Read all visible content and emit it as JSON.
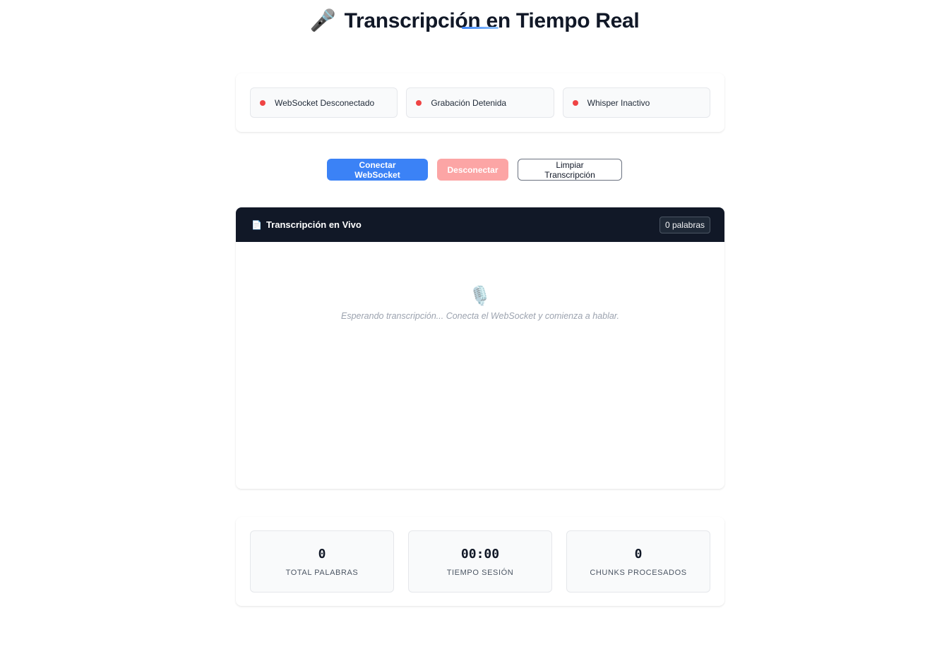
{
  "header": {
    "icon": "microphone-icon",
    "title": "Transcripción en Tiempo Real",
    "accent_color": "#3b82f6"
  },
  "status": [
    {
      "label": "WebSocket Desconectado",
      "color": "#ef4444"
    },
    {
      "label": "Grabación Detenida",
      "color": "#ef4444"
    },
    {
      "label": "Whisper Inactivo",
      "color": "#ef4444"
    }
  ],
  "controls": {
    "connect_label": "Conectar WebSocket",
    "disconnect_label": "Desconectar",
    "clear_label": "Limpiar Transcripción"
  },
  "transcript": {
    "icon": "document-icon",
    "title": "Transcripción en Vivo",
    "word_count": "0 palabras",
    "empty_icon": "microphone-icon",
    "empty_message": "Esperando transcripción... Conecta el WebSocket y comienza a hablar."
  },
  "stats": [
    {
      "value": "0",
      "label": "Total Palabras"
    },
    {
      "value": "00:00",
      "label": "Tiempo Sesión"
    },
    {
      "value": "0",
      "label": "Chunks Procesados"
    }
  ]
}
